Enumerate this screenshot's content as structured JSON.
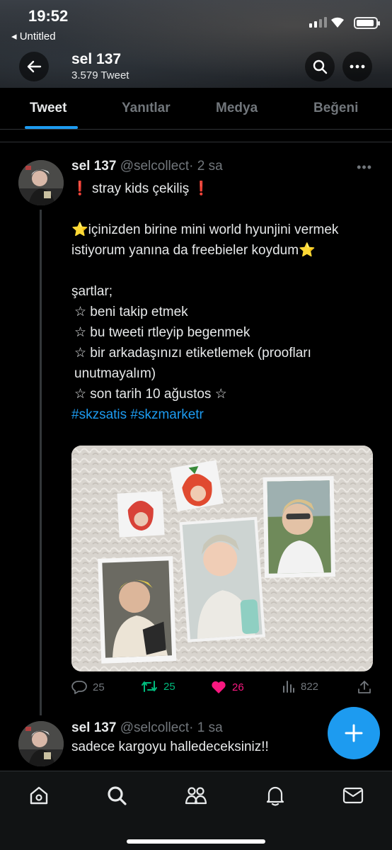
{
  "status": {
    "time": "19:52",
    "back_app": "◂ Untitled"
  },
  "profile": {
    "name": "sel 137",
    "tweet_count": "3.579 Tweet"
  },
  "tabs": [
    {
      "label": "Tweet",
      "active": true
    },
    {
      "label": "Yanıtlar",
      "active": false
    },
    {
      "label": "Medya",
      "active": false
    },
    {
      "label": "Beğeni",
      "active": false
    }
  ],
  "tweets": [
    {
      "name": "sel 137",
      "handle": "@selcollect",
      "time": "· 2 sa",
      "line1": "stray kids çekiliş",
      "para2": "içinizden birine mini world hyunjini vermek istiyorum yanına da freebieler koydum",
      "rules_title": "şartlar;",
      "rules": [
        "☆ beni takip etmek",
        "☆ bu tweeti rtleyip begenmek",
        "☆ bir arkadaşınızı etiketlemek (proofları unutmayalım)",
        "☆ son tarih 10 ağustos ☆"
      ],
      "hashtags": "#skzsatis #skzmarketr",
      "stats": {
        "replies": "25",
        "retweets": "25",
        "likes": "26",
        "views": "822"
      }
    },
    {
      "name": "sel 137",
      "handle": "@selcollect",
      "time": "· 1 sa",
      "text": "sadece kargoyu halledeceksiniz!!"
    }
  ],
  "colors": {
    "accent": "#1d9bf0",
    "retweet": "#00ba7c",
    "like": "#f91880",
    "muted": "#71767b"
  },
  "icons": {
    "bottom_nav": [
      "home-icon",
      "search-icon",
      "communities-icon",
      "notifications-icon",
      "messages-icon"
    ]
  }
}
